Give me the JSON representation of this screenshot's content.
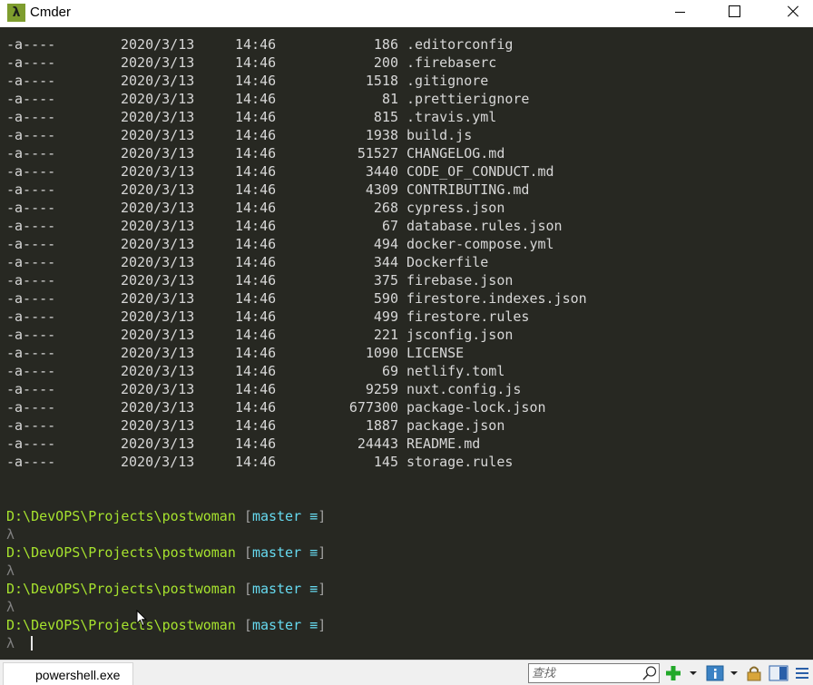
{
  "window": {
    "title": "Cmder",
    "app_icon_glyph": "λ"
  },
  "terminal": {
    "listing": [
      {
        "mode": "-a----",
        "date": "2020/3/13",
        "time": "14:46",
        "size": "186",
        "name": ".editorconfig"
      },
      {
        "mode": "-a----",
        "date": "2020/3/13",
        "time": "14:46",
        "size": "200",
        "name": ".firebaserc"
      },
      {
        "mode": "-a----",
        "date": "2020/3/13",
        "time": "14:46",
        "size": "1518",
        "name": ".gitignore"
      },
      {
        "mode": "-a----",
        "date": "2020/3/13",
        "time": "14:46",
        "size": "81",
        "name": ".prettierignore"
      },
      {
        "mode": "-a----",
        "date": "2020/3/13",
        "time": "14:46",
        "size": "815",
        "name": ".travis.yml"
      },
      {
        "mode": "-a----",
        "date": "2020/3/13",
        "time": "14:46",
        "size": "1938",
        "name": "build.js"
      },
      {
        "mode": "-a----",
        "date": "2020/3/13",
        "time": "14:46",
        "size": "51527",
        "name": "CHANGELOG.md"
      },
      {
        "mode": "-a----",
        "date": "2020/3/13",
        "time": "14:46",
        "size": "3440",
        "name": "CODE_OF_CONDUCT.md"
      },
      {
        "mode": "-a----",
        "date": "2020/3/13",
        "time": "14:46",
        "size": "4309",
        "name": "CONTRIBUTING.md"
      },
      {
        "mode": "-a----",
        "date": "2020/3/13",
        "time": "14:46",
        "size": "268",
        "name": "cypress.json"
      },
      {
        "mode": "-a----",
        "date": "2020/3/13",
        "time": "14:46",
        "size": "67",
        "name": "database.rules.json"
      },
      {
        "mode": "-a----",
        "date": "2020/3/13",
        "time": "14:46",
        "size": "494",
        "name": "docker-compose.yml"
      },
      {
        "mode": "-a----",
        "date": "2020/3/13",
        "time": "14:46",
        "size": "344",
        "name": "Dockerfile"
      },
      {
        "mode": "-a----",
        "date": "2020/3/13",
        "time": "14:46",
        "size": "375",
        "name": "firebase.json"
      },
      {
        "mode": "-a----",
        "date": "2020/3/13",
        "time": "14:46",
        "size": "590",
        "name": "firestore.indexes.json"
      },
      {
        "mode": "-a----",
        "date": "2020/3/13",
        "time": "14:46",
        "size": "499",
        "name": "firestore.rules"
      },
      {
        "mode": "-a----",
        "date": "2020/3/13",
        "time": "14:46",
        "size": "221",
        "name": "jsconfig.json"
      },
      {
        "mode": "-a----",
        "date": "2020/3/13",
        "time": "14:46",
        "size": "1090",
        "name": "LICENSE"
      },
      {
        "mode": "-a----",
        "date": "2020/3/13",
        "time": "14:46",
        "size": "69",
        "name": "netlify.toml"
      },
      {
        "mode": "-a----",
        "date": "2020/3/13",
        "time": "14:46",
        "size": "9259",
        "name": "nuxt.config.js"
      },
      {
        "mode": "-a----",
        "date": "2020/3/13",
        "time": "14:46",
        "size": "677300",
        "name": "package-lock.json"
      },
      {
        "mode": "-a----",
        "date": "2020/3/13",
        "time": "14:46",
        "size": "1887",
        "name": "package.json"
      },
      {
        "mode": "-a----",
        "date": "2020/3/13",
        "time": "14:46",
        "size": "24443",
        "name": "README.md"
      },
      {
        "mode": "-a----",
        "date": "2020/3/13",
        "time": "14:46",
        "size": "145",
        "name": "storage.rules"
      }
    ],
    "prompts": [
      {
        "path": "D:\\DevOPS\\Projects\\postwoman",
        "open": "[",
        "branch": "master ≡",
        "close": "]",
        "symbol": "λ"
      },
      {
        "path": "D:\\DevOPS\\Projects\\postwoman",
        "open": "[",
        "branch": "master ≡",
        "close": "]",
        "symbol": "λ"
      },
      {
        "path": "D:\\DevOPS\\Projects\\postwoman",
        "open": "[",
        "branch": "master ≡",
        "close": "]",
        "symbol": "λ"
      },
      {
        "path": "D:\\DevOPS\\Projects\\postwoman",
        "open": "[",
        "branch": "master ≡",
        "close": "]",
        "symbol": "λ"
      }
    ],
    "colors": {
      "background": "#272822",
      "text": "#d7d7d7",
      "path": "#a6e22e",
      "branch": "#66d9ef"
    }
  },
  "statusbar": {
    "tab_label": "powershell.exe",
    "search_placeholder": "查找",
    "icons": [
      "add-console-icon",
      "dropdown-arrow-icon",
      "info-icon",
      "dropdown-arrow-icon",
      "lock-icon",
      "split-panel-icon",
      "menu-icon"
    ]
  }
}
